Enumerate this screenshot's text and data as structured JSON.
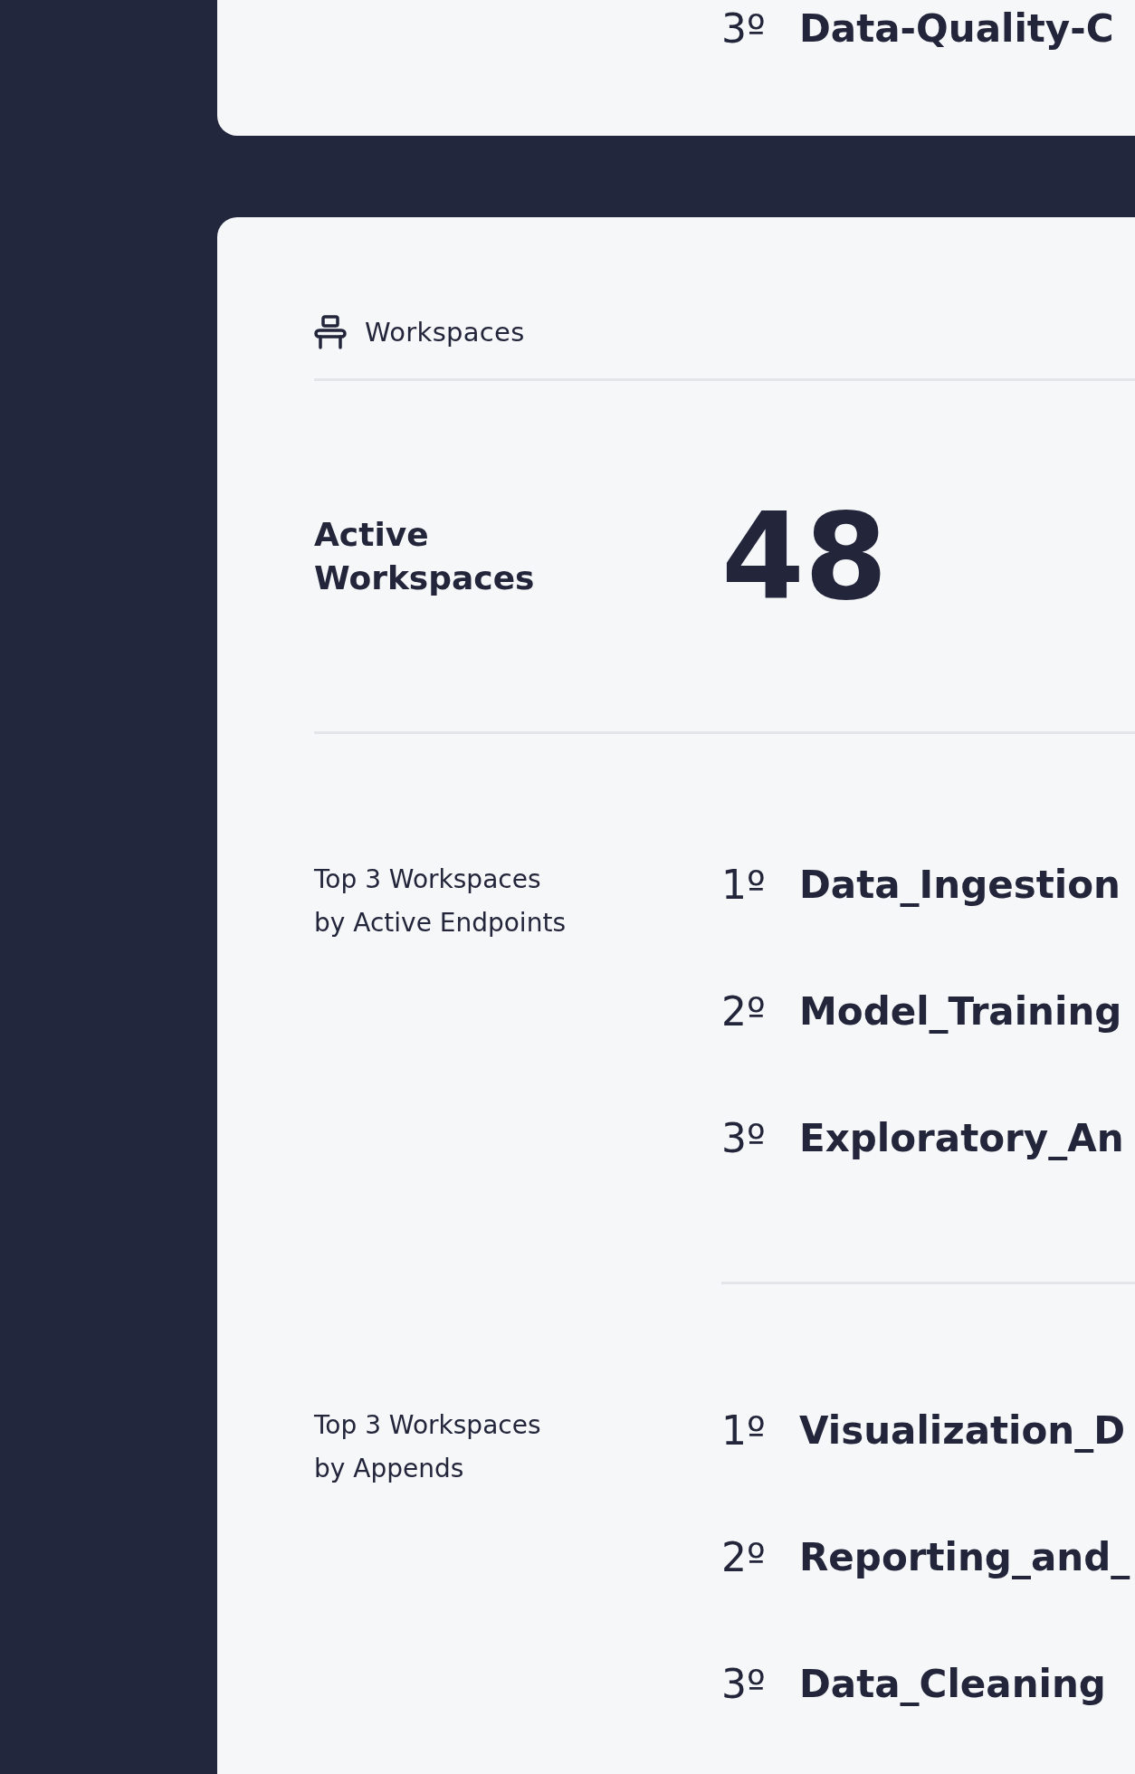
{
  "top_card": {
    "items": [
      {
        "rank": "3º",
        "name": "Data-Quality-C"
      }
    ]
  },
  "workspaces_card": {
    "header": "Workspaces",
    "metric": {
      "label_lines": [
        "Active",
        "Workspaces"
      ],
      "value": "48"
    },
    "rankings": [
      {
        "label_lines": [
          "Top 3 Workspaces",
          "by Active Endpoints"
        ],
        "items": [
          {
            "rank": "1º",
            "name": "Data_Ingestion"
          },
          {
            "rank": "2º",
            "name": "Model_Training"
          },
          {
            "rank": "3º",
            "name": "Exploratory_An"
          }
        ]
      },
      {
        "label_lines": [
          "Top 3 Workspaces",
          "by Appends"
        ],
        "items": [
          {
            "rank": "1º",
            "name": "Visualization_D"
          },
          {
            "rank": "2º",
            "name": "Reporting_and_"
          },
          {
            "rank": "3º",
            "name": "Data_Cleaning"
          }
        ]
      }
    ]
  }
}
